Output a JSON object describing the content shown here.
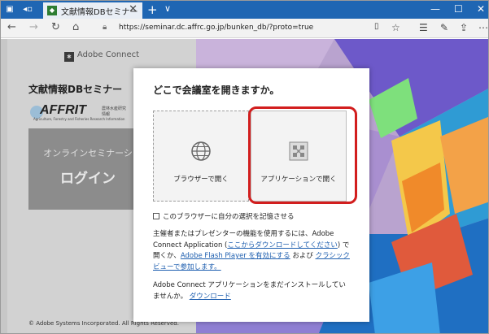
{
  "browser": {
    "tab_title": "文献情報DBセミナー",
    "tab_close": "✕",
    "new_tab": "+",
    "tab_menu": "∨",
    "url": "https://seminar.dc.affrc.go.jp/bunken_db/?proto=true",
    "win_min": "—",
    "win_max": "☐",
    "win_close": "✕"
  },
  "left_panel": {
    "header_app": "Adobe Connect",
    "seminar_title": "文献情報DBセミナー",
    "affrit_brand": "AFFRIT",
    "affrit_jp": "農林水産研究情報",
    "affrit_sub": "Agriculture, Forestry and Fisheries Research Information",
    "online_seminar": "オンラインセミナーシ",
    "login": "ログイン",
    "copyright": "© Adobe Systems Incorporated. All Rights Reserved."
  },
  "dialog": {
    "title": "どこで会議室を開きますか。",
    "browser_option": "ブラウザーで開く",
    "app_option": "アプリケーションで開く",
    "remember": "このブラウザーに自分の選択を記憶させる",
    "info1_a": "主催者またはプレゼンターの機能を使用するには、Adobe Connect Application (",
    "info1_link1": "ここからダウンロードしてください",
    "info1_b": ") で開くか、",
    "info1_link2": "Adobe Flash Player を有効にする",
    "info1_c": " および ",
    "info1_link3": "クラシックビューで参加します。",
    "info2_a": "Adobe Connect アプリケーションをまだインストールしていませんか。",
    "info2_link": "ダウンロード"
  },
  "colors": {
    "tabbar": "#1f66b3",
    "highlight": "#d21e1e",
    "link": "#2060b0"
  }
}
